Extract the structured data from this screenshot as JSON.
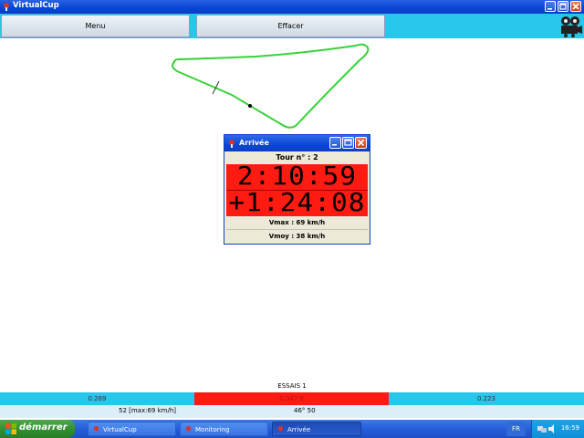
{
  "app": {
    "title": "VirtualCup"
  },
  "toolbar": {
    "menu_label": "Menu",
    "clear_label": "Effacer",
    "film_icon": "film-projector-icon"
  },
  "finish_window": {
    "title": "Arrivée",
    "lap_label": "Tour n° : 2",
    "lap_time": "2:10:59",
    "delta_time": "+1:24:08",
    "vmax": "Vmax : 69 km/h",
    "vmoy": "Vmoy : 38 km/h"
  },
  "session": {
    "label": "ESSAIS 1"
  },
  "status_bar": {
    "left": "0.269",
    "center": "0.047.0",
    "right": "0.223",
    "center_color": "#ff1a12",
    "bar_color": "#27c6ea"
  },
  "info_bar": {
    "speed": "52  [max:69 km/h]",
    "angle": "46° 50"
  },
  "taskbar": {
    "start_label": "démarrer",
    "tasks": [
      {
        "label": "VirtualCup"
      },
      {
        "label": "Monitoring"
      },
      {
        "label": "Arrivée"
      }
    ],
    "language": "FR",
    "clock": "16:59"
  }
}
